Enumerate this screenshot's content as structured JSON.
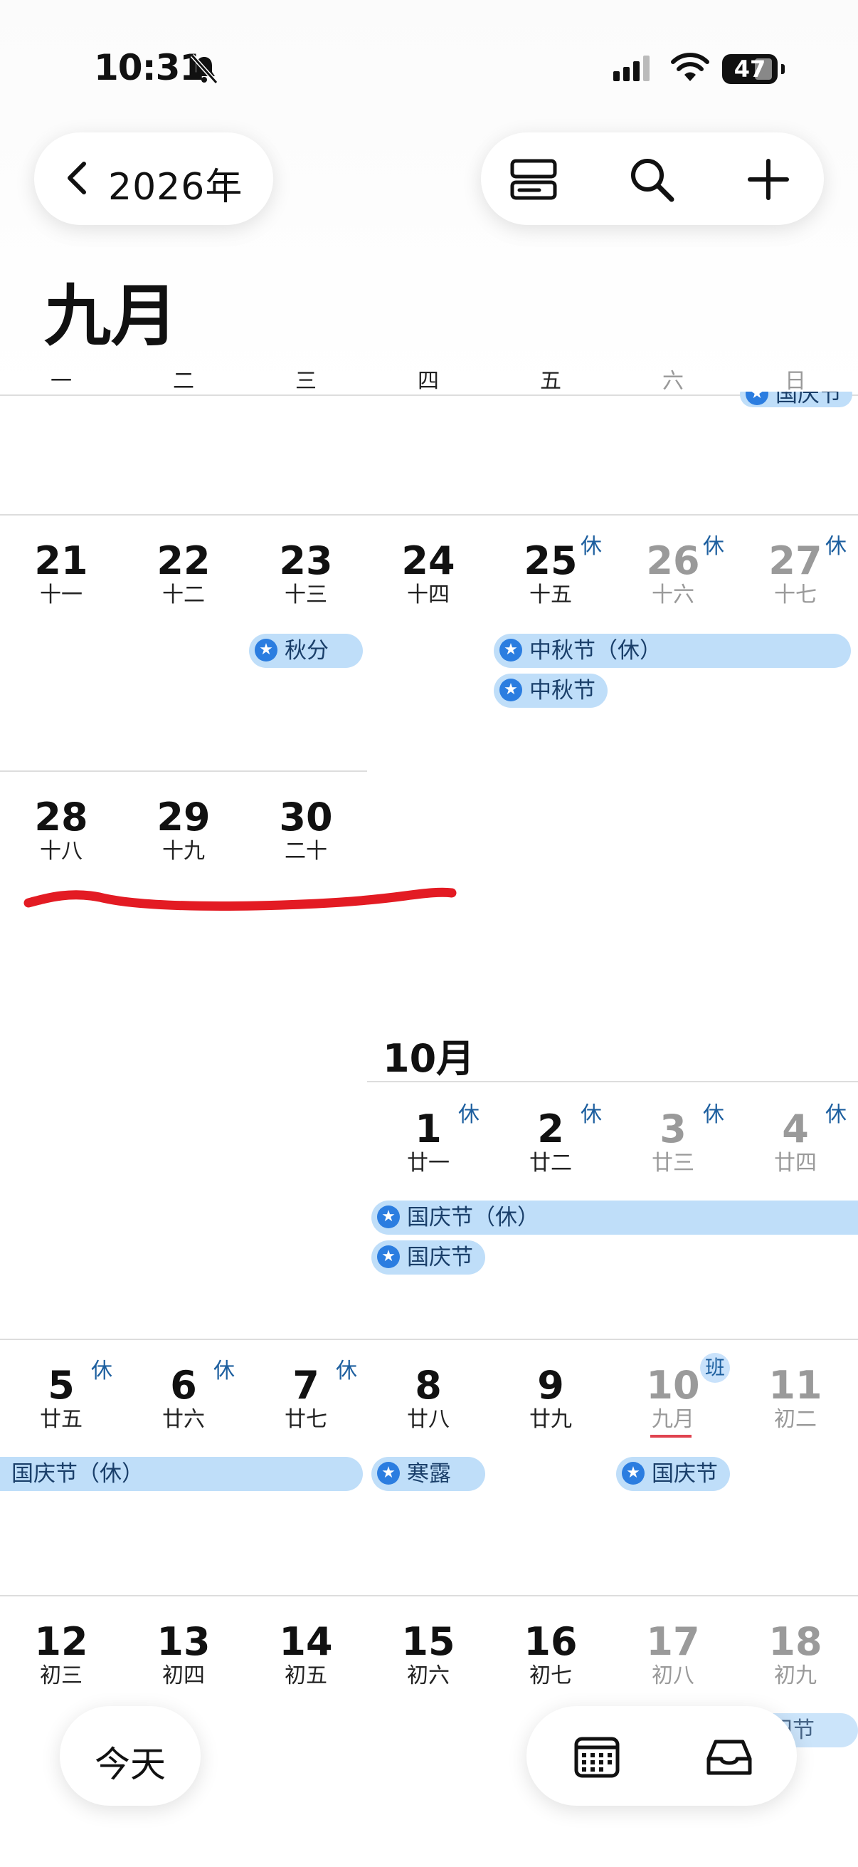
{
  "status": {
    "time": "10:31",
    "battery": "47"
  },
  "nav": {
    "year_label": "2026年"
  },
  "month_title": "九月",
  "weekdays": [
    "一",
    "二",
    "三",
    "四",
    "五",
    "六",
    "日"
  ],
  "clipped_event_top": "国庆节",
  "sep_weeks": [
    {
      "days": [
        {
          "num": "21",
          "lunar": "十一"
        },
        {
          "num": "22",
          "lunar": "十二"
        },
        {
          "num": "23",
          "lunar": "十三"
        },
        {
          "num": "24",
          "lunar": "十四"
        },
        {
          "num": "25",
          "lunar": "十五",
          "badge": "休"
        },
        {
          "num": "26",
          "lunar": "十六",
          "badge": "休"
        },
        {
          "num": "27",
          "lunar": "十七",
          "badge": "休"
        }
      ],
      "events": [
        "秋分",
        "中秋节（休）",
        "中秋节"
      ]
    },
    {
      "days": [
        {
          "num": "28",
          "lunar": "十八"
        },
        {
          "num": "29",
          "lunar": "十九"
        },
        {
          "num": "30",
          "lunar": "二十"
        }
      ]
    }
  ],
  "oct_title": "10月",
  "oct_weeks": [
    {
      "days": [
        {
          "num": "1",
          "lunar": "廿一",
          "badge": "休"
        },
        {
          "num": "2",
          "lunar": "廿二",
          "badge": "休"
        },
        {
          "num": "3",
          "lunar": "廿三",
          "badge": "休"
        },
        {
          "num": "4",
          "lunar": "廿四",
          "badge": "休"
        }
      ],
      "events": [
        "国庆节（休）",
        "国庆节"
      ]
    },
    {
      "days": [
        {
          "num": "5",
          "lunar": "廿五",
          "badge": "休"
        },
        {
          "num": "6",
          "lunar": "廿六",
          "badge": "休"
        },
        {
          "num": "7",
          "lunar": "廿七",
          "badge": "休"
        },
        {
          "num": "8",
          "lunar": "廿八"
        },
        {
          "num": "9",
          "lunar": "廿九"
        },
        {
          "num": "10",
          "lunar": "九月",
          "badge": "班"
        },
        {
          "num": "11",
          "lunar": "初二"
        }
      ],
      "events": [
        "国庆节（休）",
        "寒露",
        "国庆节"
      ]
    },
    {
      "days": [
        {
          "num": "12",
          "lunar": "初三"
        },
        {
          "num": "13",
          "lunar": "初四"
        },
        {
          "num": "14",
          "lunar": "初五"
        },
        {
          "num": "15",
          "lunar": "初六"
        },
        {
          "num": "16",
          "lunar": "初七"
        },
        {
          "num": "17",
          "lunar": "初八"
        },
        {
          "num": "18",
          "lunar": "初九"
        }
      ],
      "events": [
        "重阳节"
      ]
    }
  ],
  "bottom": {
    "today_label": "今天"
  },
  "colors": {
    "event_bg": "#bfdef9",
    "accent_blue": "#2b7de0",
    "annotation_red": "#e31b23"
  },
  "icons": {
    "back": "chevron-left-icon",
    "view": "layout-icon",
    "search": "search-icon",
    "add": "plus-icon",
    "calendar": "calendar-grid-icon",
    "inbox": "inbox-icon"
  }
}
